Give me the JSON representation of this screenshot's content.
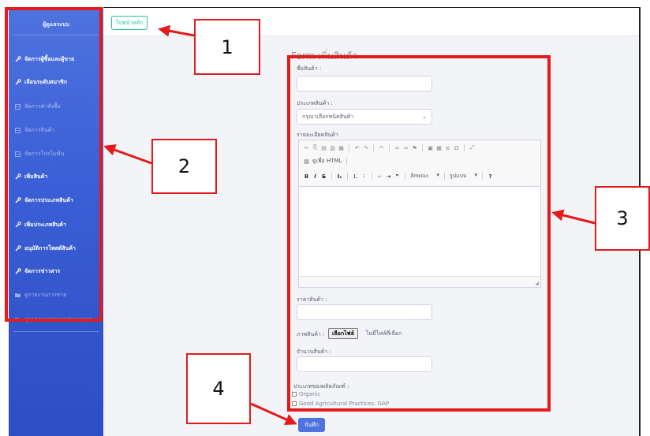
{
  "sidebar": {
    "brand": "ผู้ดูแลระบบ",
    "items": [
      {
        "label": "จัดการผู้ซื้อและผู้ขาย",
        "icon": "wrench-icon",
        "active": true
      },
      {
        "label": "เลือนระดับสมาชิก",
        "icon": "wrench-icon",
        "active": true
      },
      {
        "label": "จัดการคำสั่งซื้อ",
        "icon": "table-icon",
        "active": false
      },
      {
        "label": "จัดการสินค้า",
        "icon": "table-icon",
        "active": false
      },
      {
        "label": "จัดการโปรโมชั่น",
        "icon": "table-icon",
        "active": false
      },
      {
        "label": "เพิ่มสินค้า",
        "icon": "wrench-icon",
        "active": true
      },
      {
        "label": "จัดการประเภทสินค้า",
        "icon": "wrench-icon",
        "active": true
      },
      {
        "label": "เพิ่มประเภทสินค้า",
        "icon": "wrench-icon",
        "active": true
      },
      {
        "label": "อนุมัติการโพสต์สินค้า",
        "icon": "wrench-icon",
        "active": true
      },
      {
        "label": "จัดการข่าวสาร",
        "icon": "wrench-icon",
        "active": true
      },
      {
        "label": "ดูรายงานการขาย",
        "icon": "folder-icon",
        "active": false
      },
      {
        "label": "ดูรายงานยอดขายส่วนบุคคล",
        "icon": "folder-icon",
        "active": false
      }
    ]
  },
  "topbar": {
    "home_label": "ไปหน้าหลัก"
  },
  "form": {
    "title": "Form เพิ่มสินค้า",
    "name_label": "ชื่อสินค้า :",
    "type_label": "ประเภทสินค้า :",
    "type_selected": "กรุณาเลือกชนิดสินค้า",
    "detail_label": "รายละเอียดสินค้า",
    "editor": {
      "source_label": "ดูเพื่อ HTML",
      "format_label": "ลักษณะ",
      "style_label": "รูปแบบ"
    },
    "price_label": "ราคาสินค้า :",
    "image_label": "ภาพสินค้า :",
    "file_button": "เลือกไฟล์",
    "file_status": "ไม่มีไฟล์ที่เลือก",
    "qty_label": "จำนวนสินค้า :",
    "product_kind_label": "ประเภทของผลิตภัณฑ์ :",
    "options": [
      "Organic",
      "Good Agricultural Practices: GAP"
    ],
    "save_label": "บันทึก"
  },
  "callouts": [
    "1",
    "2",
    "3",
    "4"
  ],
  "colors": {
    "annotation": "#e31b1b",
    "primary": "#4e73df",
    "success": "#1cc88a"
  }
}
